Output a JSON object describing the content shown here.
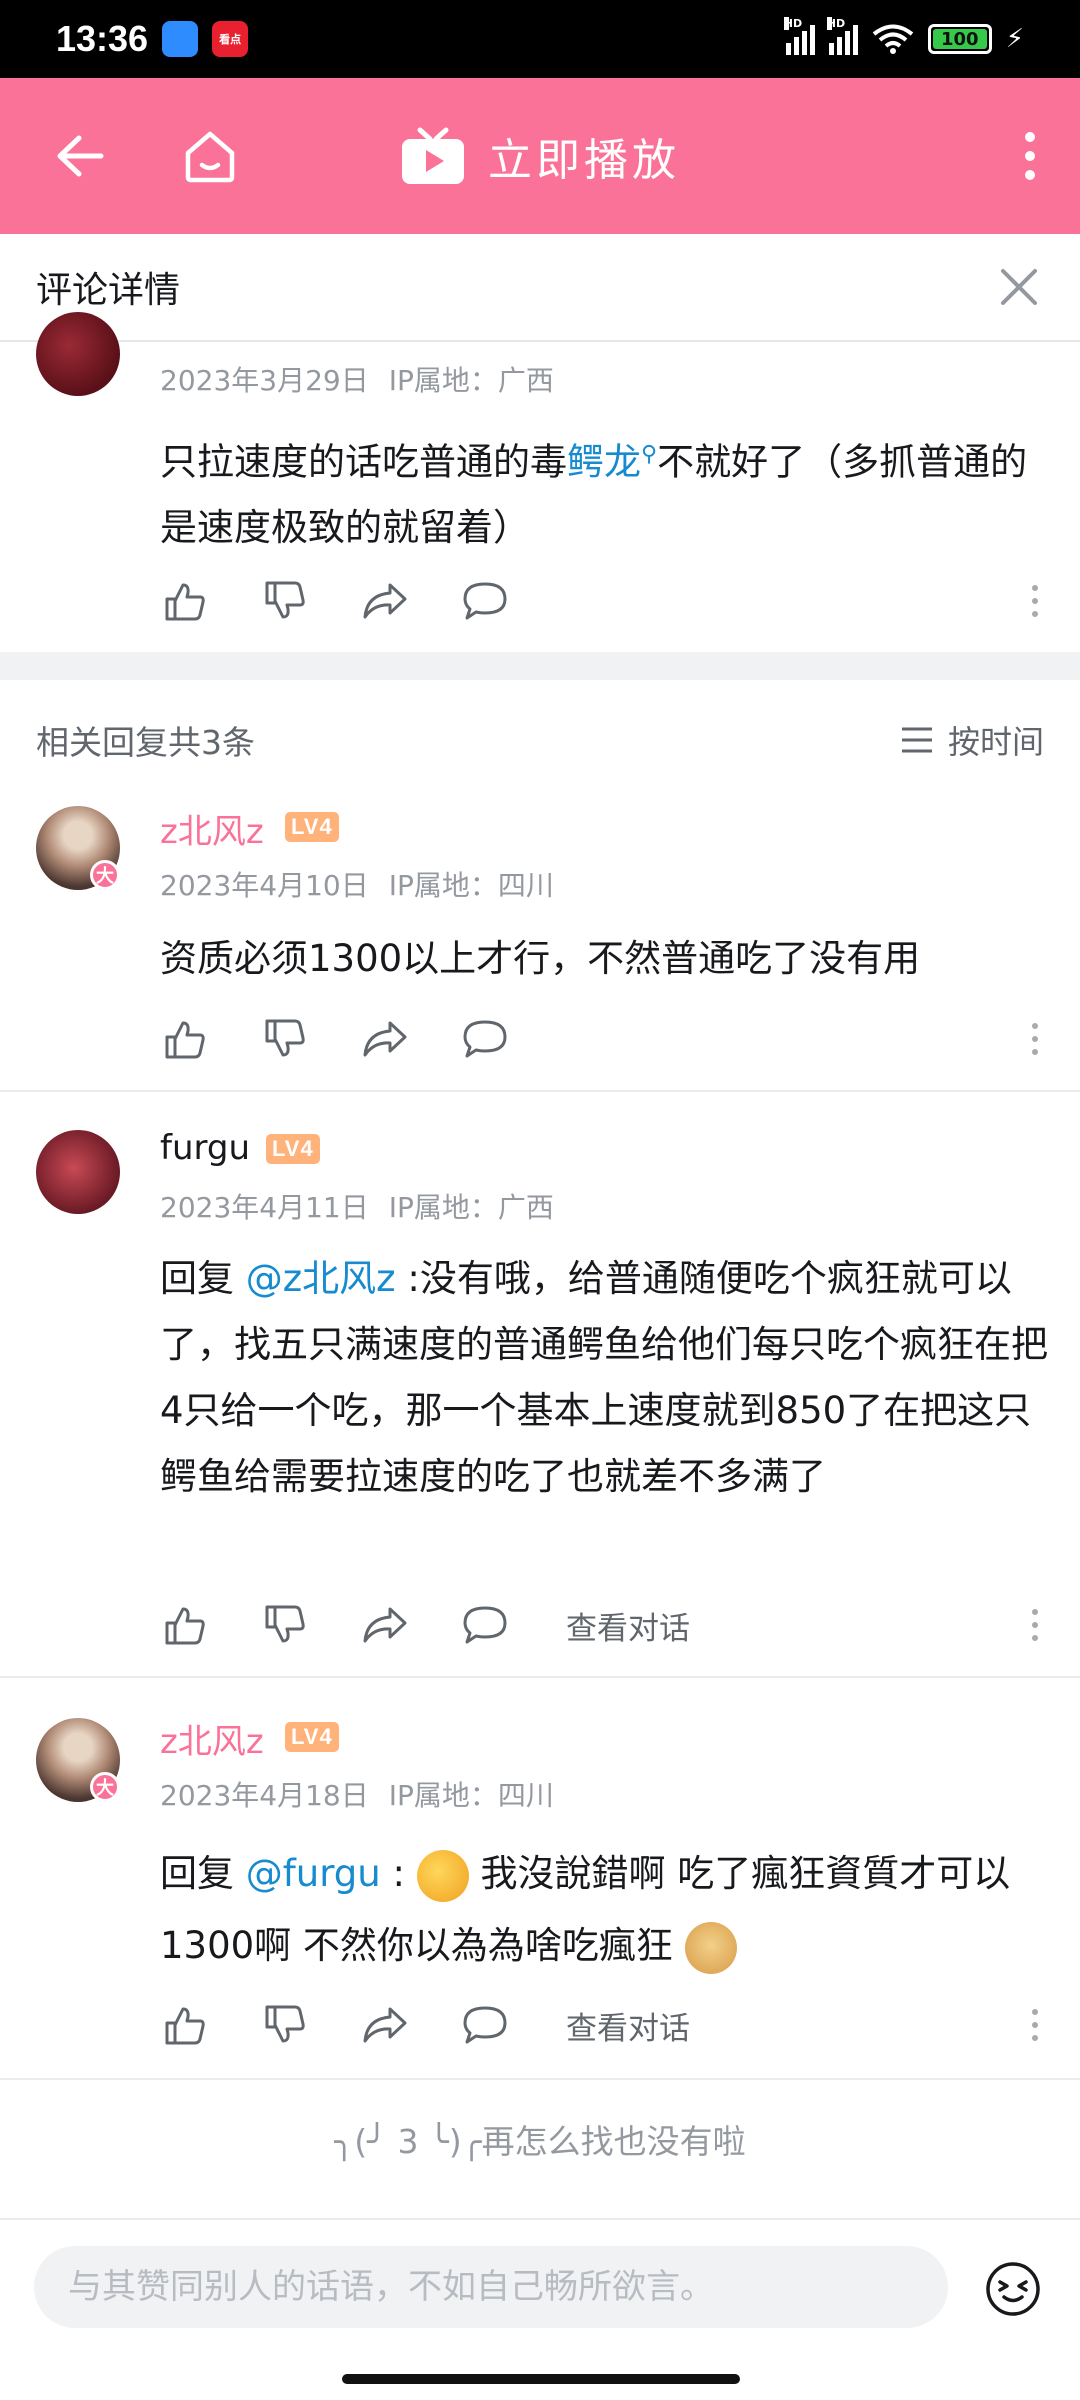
{
  "status_bar": {
    "time": "13:36",
    "battery": "100",
    "app_icon_text": "看点"
  },
  "header": {
    "play_label": "立即播放"
  },
  "detail": {
    "title": "评论详情"
  },
  "main_comment": {
    "date": "2023年3月29日",
    "ip": "IP属地：广西",
    "text_before": "只拉速度的话吃普通的毒",
    "link": "鳄龙",
    "text_after": "不就好了（多抓普通的是速度极致的就留着）"
  },
  "replies_header": {
    "count_label": "相关回复共3条",
    "sort_label": "按时间"
  },
  "replies": [
    {
      "username": "z北风z",
      "level": "LV4",
      "date": "2023年4月10日",
      "ip": "IP属地：四川",
      "text": "资质必须1300以上才行，不然普通吃了没有用"
    },
    {
      "username": "furgu",
      "level": "LV4",
      "date": "2023年4月11日",
      "ip": "IP属地：广西",
      "prefix": "回复 ",
      "mention": "@z北风z",
      "text": " :没有哦，给普通随便吃个疯狂就可以了，找五只满速度的普通鳄鱼给他们每只吃个疯狂在把4只给一个吃，那一个基本上速度就到850了在把这只鳄鱼给需要拉速度的吃了也就差不多满了",
      "view_conv": "查看对话"
    },
    {
      "username": "z北风z",
      "level": "LV4",
      "date": "2023年4月18日",
      "ip": "IP属地：四川",
      "prefix": "回复 ",
      "mention": "@furgu",
      "text_a": " : ",
      "text_b": " 我沒說錯啊 吃了瘋狂資質才可以1300啊 不然你以為為啥吃瘋狂 ",
      "view_conv": "查看对话"
    }
  ],
  "avatar_badge": "大",
  "end_text": "╮(╯ 3 ╰)╭再怎么找也没有啦",
  "input": {
    "placeholder": "与其赞同别人的话语，不如自己畅所欲言。"
  },
  "colors": {
    "accent": "#fb7299",
    "link": "#178bcf",
    "muted": "#9499a0"
  }
}
